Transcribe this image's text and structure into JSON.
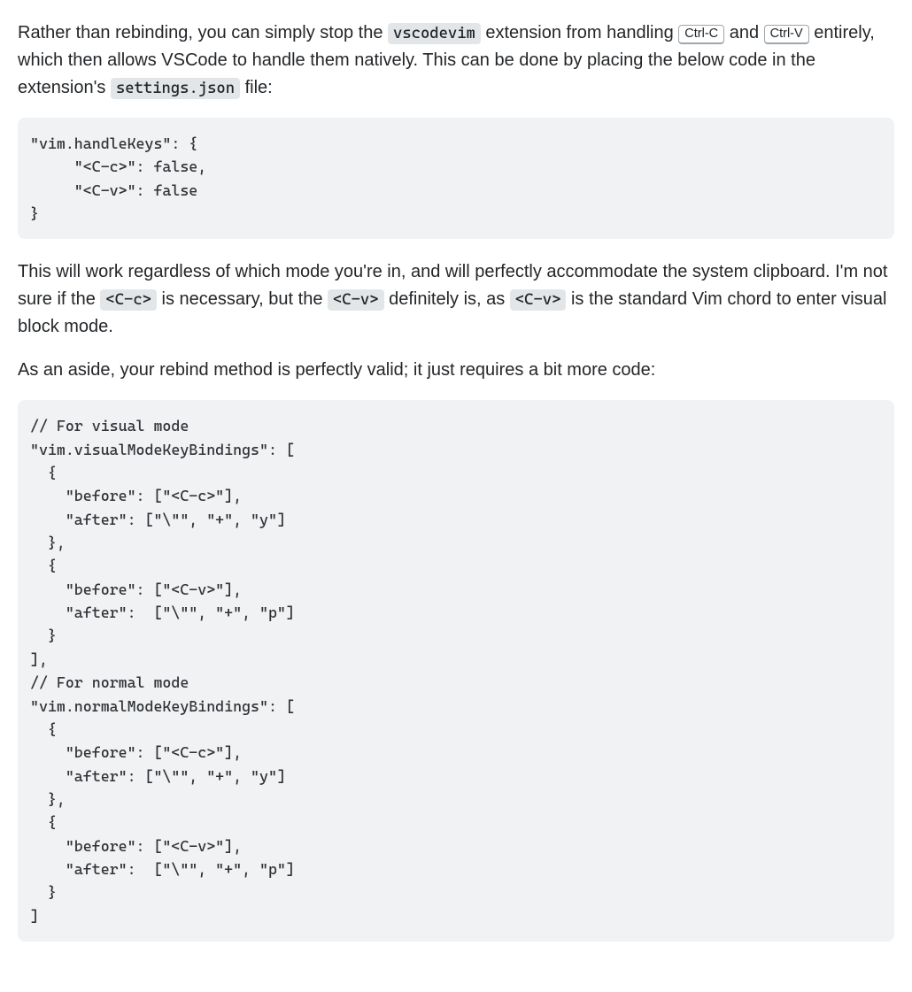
{
  "para1": {
    "t1": "Rather than rebinding, you can simply stop the ",
    "code1": "vscodevim",
    "t2": " extension from handling ",
    "kbd1": "Ctrl-C",
    "t3": " and ",
    "kbd2": "Ctrl-V",
    "t4": " entirely, which then allows VSCode to handle them natively. This can be done by placing the below code in the extension's ",
    "code2": "settings.json",
    "t5": " file:"
  },
  "codeblock1": "\"vim.handleKeys\": {\n     \"<C-c>\": false,\n     \"<C-v>\": false\n}",
  "para2": {
    "t1": "This will work regardless of which mode you're in, and will perfectly accommodate the system clipboard. I'm not sure if the ",
    "code1": "<C-c>",
    "t2": " is necessary, but the ",
    "code2": "<C-v>",
    "t3": " definitely is, as ",
    "code3": "<C-v>",
    "t4": " is the standard Vim chord to enter visual block mode."
  },
  "para3": {
    "t1": "As an aside, your rebind method is perfectly valid; it just requires a bit more code:"
  },
  "codeblock2": "// For visual mode\n\"vim.visualModeKeyBindings\": [\n  {\n    \"before\": [\"<C-c>\"],\n    \"after\": [\"\\\"\", \"+\", \"y\"]\n  },\n  {\n    \"before\": [\"<C-v>\"],\n    \"after\":  [\"\\\"\", \"+\", \"p\"]\n  }\n],\n// For normal mode\n\"vim.normalModeKeyBindings\": [\n  {\n    \"before\": [\"<C-c>\"],\n    \"after\": [\"\\\"\", \"+\", \"y\"]\n  },\n  {\n    \"before\": [\"<C-v>\"],\n    \"after\":  [\"\\\"\", \"+\", \"p\"]\n  }\n]"
}
